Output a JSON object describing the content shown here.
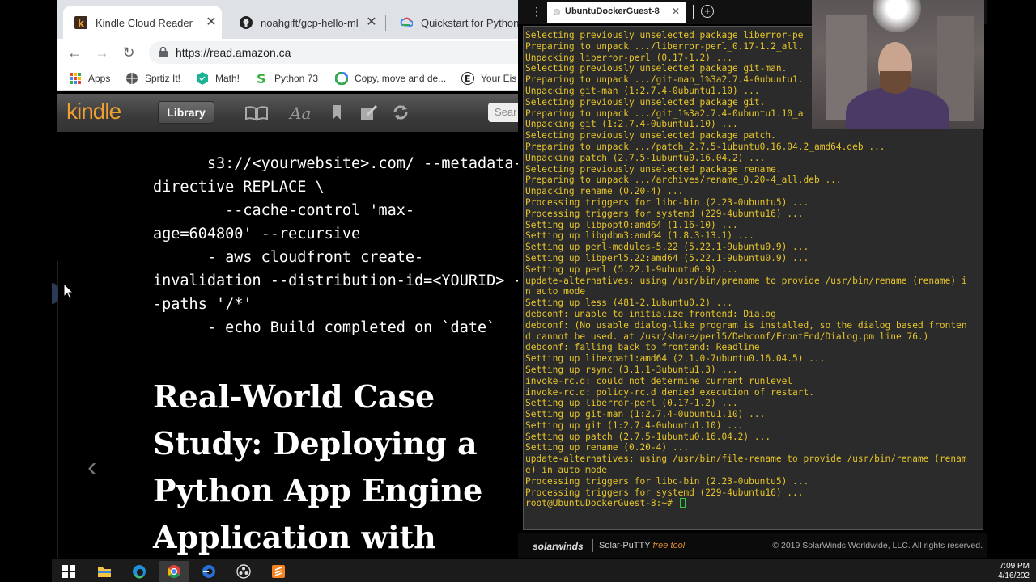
{
  "browser": {
    "tabs": [
      {
        "title": "Kindle Cloud Reader",
        "active": true
      },
      {
        "title": "noahgift/gcp-hello-ml",
        "active": false
      },
      {
        "title": "Quickstart for Python 3",
        "active": false
      }
    ],
    "url": "https://read.amazon.ca",
    "bookmarks": [
      {
        "label": "Apps",
        "icon": "apps-grid-icon"
      },
      {
        "label": "Sprtiz It!",
        "icon": "globe-icon"
      },
      {
        "label": "Math!",
        "icon": "hexagon-icon"
      },
      {
        "label": "Python 73",
        "icon": "s-logo-icon"
      },
      {
        "label": "Copy, move and de...",
        "icon": "copy-icon"
      },
      {
        "label": "Your Eis",
        "icon": "e-logo-icon"
      }
    ]
  },
  "kindle": {
    "logo": "kindle",
    "library_label": "Library",
    "search_placeholder": "Sear",
    "code_lines": [
      "      s3://<yourwebsite>.com/ --metadata-",
      "directive REPLACE \\",
      "        --cache-control 'max-",
      "age=604800' --recursive",
      "      - aws cloudfront create-",
      "invalidation --distribution-id=<YOURID> -",
      "-paths '/*'",
      "      - echo Build completed on `date`"
    ],
    "heading_lines": [
      "Real-World Case",
      "Study: Deploying a",
      "Python App Engine",
      "Application with"
    ],
    "prev_page_symbol": "‹"
  },
  "putty": {
    "tab_title": "UbuntuDockerGuest-8",
    "menu_symbol": "⋮",
    "add_symbol": "+",
    "terminal_lines": [
      "Selecting previously unselected package liberror-pe",
      "Preparing to unpack .../liberror-perl_0.17-1.2_all.",
      "Unpacking liberror-perl (0.17-1.2) ...",
      "Selecting previously unselected package git-man.",
      "Preparing to unpack .../git-man_1%3a2.7.4-0ubuntu1.",
      "Unpacking git-man (1:2.7.4-0ubuntu1.10) ...",
      "Selecting previously unselected package git.",
      "Preparing to unpack .../git_1%3a2.7.4-0ubuntu1.10_a",
      "Unpacking git (1:2.7.4-0ubuntu1.10) ...",
      "Selecting previously unselected package patch.",
      "Preparing to unpack .../patch_2.7.5-1ubuntu0.16.04.2_amd64.deb ...",
      "Unpacking patch (2.7.5-1ubuntu0.16.04.2) ...",
      "Selecting previously unselected package rename.",
      "Preparing to unpack .../archives/rename_0.20-4_all.deb ...",
      "Unpacking rename (0.20-4) ...",
      "Processing triggers for libc-bin (2.23-0ubuntu5) ...",
      "Processing triggers for systemd (229-4ubuntu16) ...",
      "Setting up libpopt0:amd64 (1.16-10) ...",
      "Setting up libgdbm3:amd64 (1.8.3-13.1) ...",
      "Setting up perl-modules-5.22 (5.22.1-9ubuntu0.9) ...",
      "Setting up libperl5.22:amd64 (5.22.1-9ubuntu0.9) ...",
      "Setting up perl (5.22.1-9ubuntu0.9) ...",
      "update-alternatives: using /usr/bin/prename to provide /usr/bin/rename (rename) i",
      "n auto mode",
      "Setting up less (481-2.1ubuntu0.2) ...",
      "debconf: unable to initialize frontend: Dialog",
      "debconf: (No usable dialog-like program is installed, so the dialog based fronten",
      "d cannot be used. at /usr/share/perl5/Debconf/FrontEnd/Dialog.pm line 76.)",
      "debconf: falling back to frontend: Readline",
      "Setting up libexpat1:amd64 (2.1.0-7ubuntu0.16.04.5) ...",
      "Setting up rsync (3.1.1-3ubuntu1.3) ...",
      "invoke-rc.d: could not determine current runlevel",
      "invoke-rc.d: policy-rc.d denied execution of restart.",
      "Setting up liberror-perl (0.17-1.2) ...",
      "Setting up git-man (1:2.7.4-0ubuntu1.10) ...",
      "Setting up git (1:2.7.4-0ubuntu1.10) ...",
      "Setting up patch (2.7.5-1ubuntu0.16.04.2) ...",
      "Setting up rename (0.20-4) ...",
      "update-alternatives: using /usr/bin/file-rename to provide /usr/bin/rename (renam",
      "e) in auto mode",
      "Processing triggers for libc-bin (2.23-0ubuntu5) ...",
      "Processing triggers for systemd (229-4ubuntu16) ..."
    ],
    "prompt": "root@UbuntuDockerGuest-8:~# ",
    "footer": {
      "logo": "solarwinds",
      "product": "Solar-PuTTY",
      "free_label": "free tool",
      "copyright": "© 2019 SolarWinds Worldwide, LLC. All rights reserved."
    }
  },
  "taskbar": {
    "apps": [
      {
        "name": "windows-start-icon",
        "active": false
      },
      {
        "name": "file-explorer-icon",
        "active": false
      },
      {
        "name": "edge-icon",
        "active": false
      },
      {
        "name": "chrome-icon",
        "active": true
      },
      {
        "name": "edge-dev-icon",
        "active": false
      },
      {
        "name": "obs-icon",
        "active": false
      },
      {
        "name": "sublime-icon",
        "active": false
      }
    ],
    "time": "7:09 PM",
    "date": "4/16/202"
  },
  "colors": {
    "terminal_text": "#e6c52a",
    "terminal_bg": "#2b2b2b",
    "kindle_orange": "#f0a030",
    "cursor_green": "#2ecc40"
  }
}
